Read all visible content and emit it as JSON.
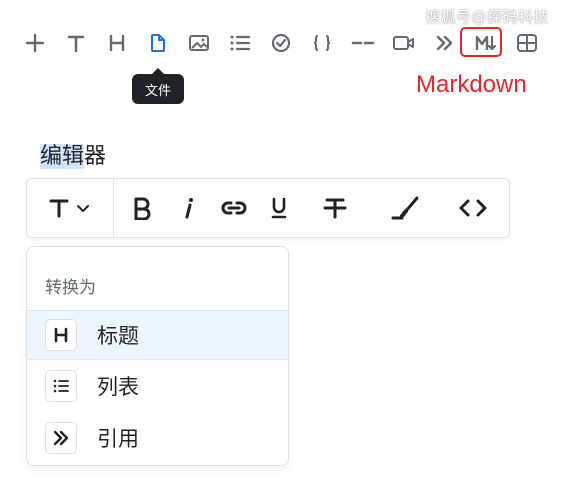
{
  "watermark": "搜狐号@探码科技",
  "toolbar": {
    "items": [
      {
        "name": "add-icon",
        "glyph": "+"
      },
      {
        "name": "text-icon",
        "glyph": "T"
      },
      {
        "name": "heading-icon",
        "glyph": "H"
      },
      {
        "name": "file-icon",
        "glyph": "file"
      },
      {
        "name": "image-icon",
        "glyph": "image"
      },
      {
        "name": "list-icon",
        "glyph": "list"
      },
      {
        "name": "todo-icon",
        "glyph": "check"
      },
      {
        "name": "code-block-icon",
        "glyph": "{}"
      },
      {
        "name": "divider-icon",
        "glyph": "--"
      },
      {
        "name": "video-icon",
        "glyph": "video"
      },
      {
        "name": "quote-icon",
        "glyph": "»"
      },
      {
        "name": "markdown-icon",
        "glyph": "M↓"
      },
      {
        "name": "table-icon",
        "glyph": "table"
      }
    ],
    "active_color": "#1f6fe5",
    "icon_color": "#646a73"
  },
  "tooltip": {
    "text": "文件"
  },
  "annotation": {
    "markdown_label": "Markdown",
    "color": "#e3262a"
  },
  "editor": {
    "text_selected": "编辑",
    "text_rest": "器"
  },
  "format_bar": {
    "text_style_glyph": "T",
    "items": [
      "bold",
      "italic",
      "link",
      "underline",
      "strikethrough",
      "highlight",
      "code"
    ]
  },
  "convert_menu": {
    "header": "转换为",
    "items": [
      {
        "label": "标题",
        "icon": "H"
      },
      {
        "label": "列表",
        "icon": "list"
      },
      {
        "label": "引用",
        "icon": "»"
      }
    ]
  }
}
